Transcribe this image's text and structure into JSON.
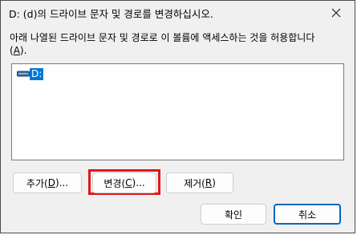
{
  "dialog": {
    "title": "D: (d)의 드라이브 문자 및 경로를 변경하십시오.",
    "description_main": "아래 나열된 드라이브 문자 및 경로로 이 볼륨에 액세스하는 것을 허용합니다",
    "description_accel_open": "(",
    "description_accel_key": "A",
    "description_accel_close": ").",
    "close_icon": "close-icon"
  },
  "list": {
    "items": [
      {
        "label": "D:",
        "icon": "drive-icon",
        "selected": true
      }
    ]
  },
  "buttons": {
    "add": {
      "pre": "추가(",
      "key": "D",
      "post": ")..."
    },
    "change": {
      "pre": "변경(",
      "key": "C",
      "post": ")..."
    },
    "remove": {
      "pre": "제거(",
      "key": "R",
      "post": ")"
    },
    "ok": "확인",
    "cancel": "취소"
  },
  "colors": {
    "highlight_border": "#e01818",
    "selection_bg": "#0078d7",
    "default_button_border": "#0067c0"
  }
}
